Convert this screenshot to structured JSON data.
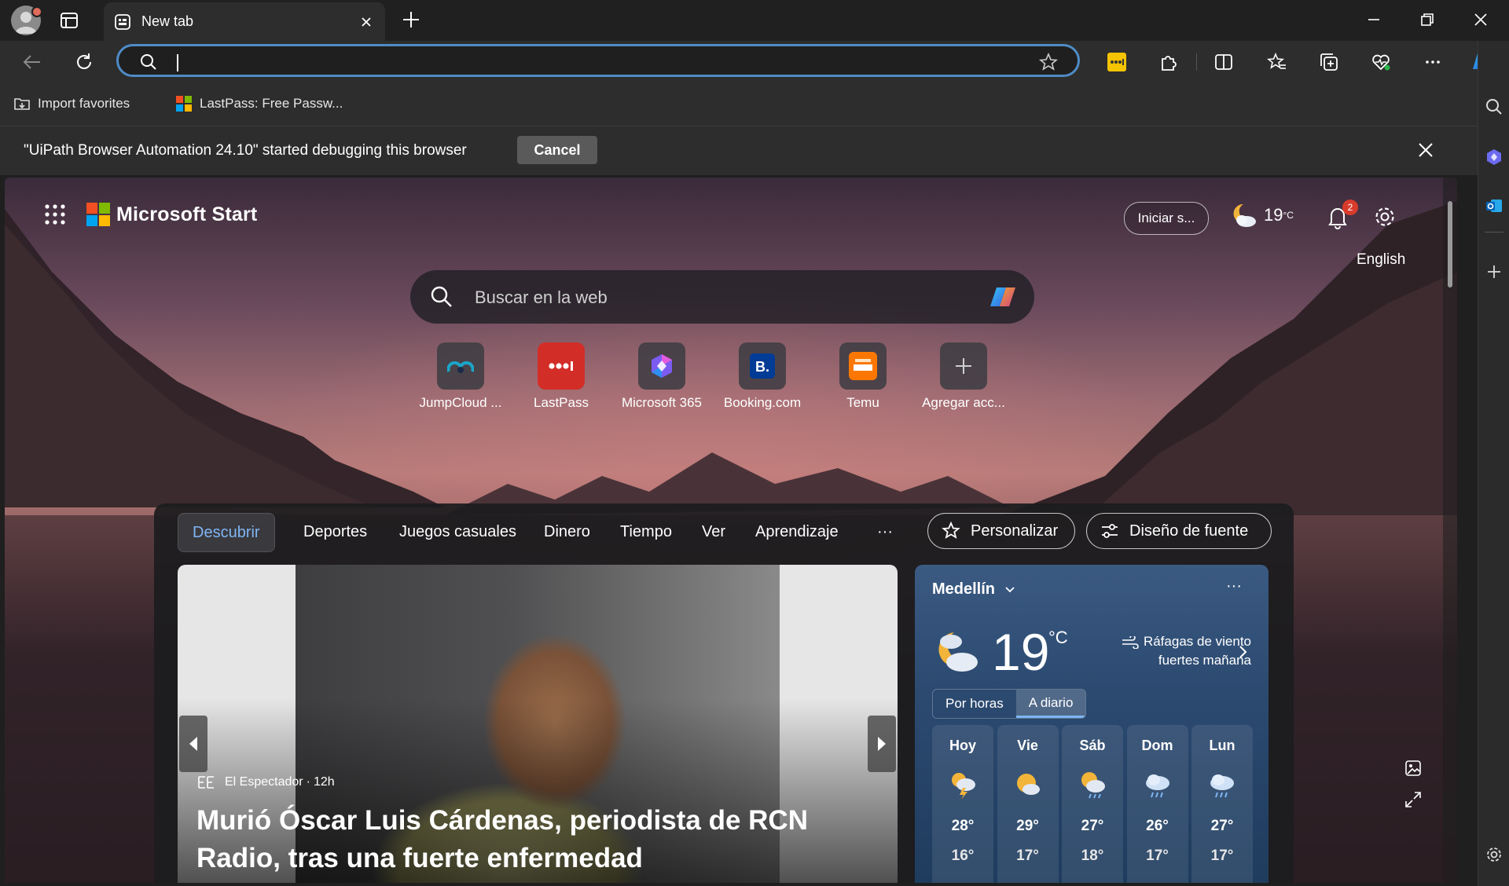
{
  "browser": {
    "tab": {
      "title": "New tab"
    },
    "address_bar": {
      "value": ""
    },
    "favorites_bar": [
      {
        "label": "Import favorites"
      },
      {
        "label": "LastPass: Free Passw..."
      }
    ],
    "infobar": {
      "message": "\"UiPath Browser Automation 24.10\" started debugging this browser",
      "cancel_label": "Cancel"
    }
  },
  "page": {
    "brand": "Microsoft Start",
    "signin_label": "Iniciar s...",
    "header_weather": {
      "temp": "19",
      "unit": "°C"
    },
    "notifications_count": "2",
    "language_link": "English",
    "search": {
      "placeholder": "Buscar en la web"
    },
    "quick_links": [
      {
        "label": "JumpCloud ...",
        "icon": "jumpcloud-icon"
      },
      {
        "label": "LastPass",
        "icon": "lastpass-icon"
      },
      {
        "label": "Microsoft 365",
        "icon": "microsoft-365-icon"
      },
      {
        "label": "Booking.com",
        "icon": "booking-icon"
      },
      {
        "label": "Temu",
        "icon": "temu-icon"
      },
      {
        "label": "Agregar acc...",
        "icon": "plus-icon"
      }
    ],
    "feed_tabs": [
      {
        "label": "Descubrir",
        "active": true
      },
      {
        "label": "Deportes"
      },
      {
        "label": "Juegos casuales"
      },
      {
        "label": "Dinero"
      },
      {
        "label": "Tiempo"
      },
      {
        "label": "Ver"
      },
      {
        "label": "Aprendizaje"
      },
      {
        "label": "···"
      }
    ],
    "personalize_label": "Personalizar",
    "layout_label": "Diseño de fuente",
    "hero_story": {
      "source": "El Espectador",
      "age": "12h",
      "title": "Murió Óscar Luis Cárdenas, periodista de RCN Radio, tras una fuerte enfermedad"
    },
    "weather_card": {
      "city": "Medellín",
      "more": "···",
      "temp": "19",
      "unit": "°C",
      "alert_line1": "Ráfagas de viento",
      "alert_line2": "fuertes mañana",
      "toggle": [
        "Por horas",
        "A diario"
      ],
      "days": [
        {
          "name": "Hoy",
          "hi": "28°",
          "lo": "16°",
          "icon": "thunderstorm-icon"
        },
        {
          "name": "Vie",
          "hi": "29°",
          "lo": "17°",
          "icon": "partly-sunny-icon"
        },
        {
          "name": "Sáb",
          "hi": "27°",
          "lo": "18°",
          "icon": "sun-rain-icon"
        },
        {
          "name": "Dom",
          "hi": "26°",
          "lo": "17°",
          "icon": "rain-cloud-icon"
        },
        {
          "name": "Lun",
          "hi": "27°",
          "lo": "17°",
          "icon": "rain-cloud-icon"
        }
      ]
    }
  },
  "colors": {
    "accent": "#4f8bc6",
    "active_tab_text": "#7fb6f5",
    "badge": "#d83b2b"
  }
}
